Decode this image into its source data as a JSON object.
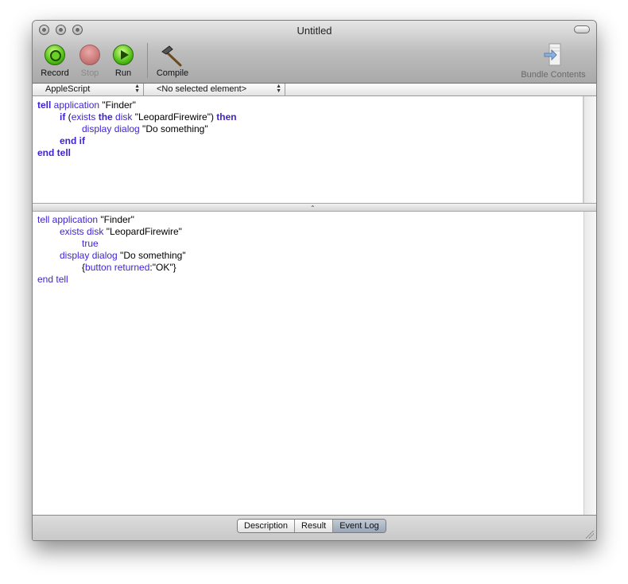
{
  "window": {
    "title": "Untitled"
  },
  "toolbar": {
    "record_label": "Record",
    "stop_label": "Stop",
    "run_label": "Run",
    "compile_label": "Compile",
    "bundle_label": "Bundle Contents"
  },
  "navbar": {
    "language": "AppleScript",
    "element": "<No selected element>"
  },
  "script": {
    "l1": {
      "a": "tell",
      "b": " application",
      "c": " \"Finder\""
    },
    "l2": {
      "a": "if",
      "b": " (",
      "c": "exists",
      "d": " the",
      "e": " disk",
      "f": " \"LeopardFirewire\")",
      "g": " then"
    },
    "l3": {
      "a": "display dialog",
      "b": " \"Do something\""
    },
    "l4": {
      "a": "end if"
    },
    "l5": {
      "a": "end tell"
    }
  },
  "log": {
    "l1": {
      "a": "tell application",
      "b": " \"Finder\""
    },
    "l2": {
      "a": "exists disk",
      "b": " \"LeopardFirewire\""
    },
    "l3": {
      "a": "true"
    },
    "l4": {
      "a": "display dialog",
      "b": " \"Do something\""
    },
    "l5": {
      "a": "{",
      "b": "button returned",
      "c": ":\"OK\"}"
    },
    "l6": {
      "a": "end tell"
    }
  },
  "bottom_tabs": [
    "Description",
    "Result",
    "Event Log"
  ],
  "selected_tab": "Event Log"
}
